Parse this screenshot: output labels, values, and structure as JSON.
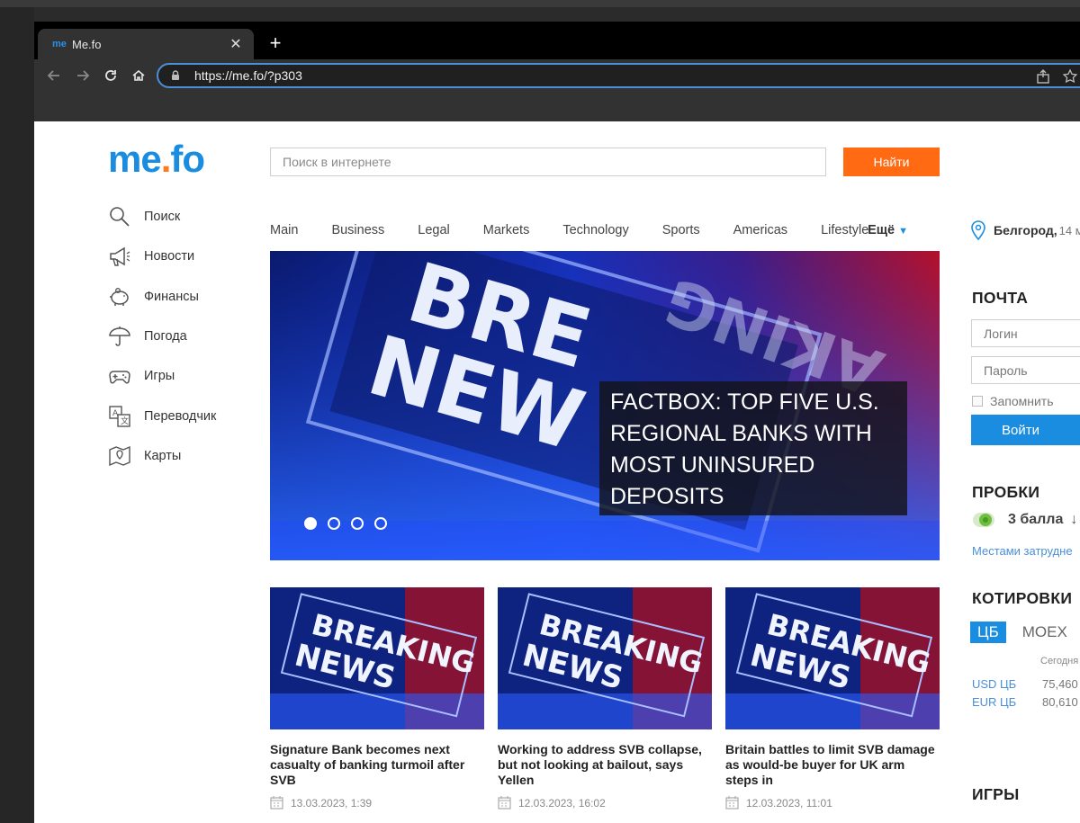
{
  "browser": {
    "tab_title": "Me.fo",
    "tab_favicon": "me",
    "url": "https://me.fo/?p303"
  },
  "site": {
    "logo_me": "me",
    "logo_dot": ".",
    "logo_fo": "fo",
    "search_placeholder": "Поиск в интернете",
    "search_button": "Найти",
    "sidenav": [
      {
        "label": "Поиск",
        "icon": "search-icon"
      },
      {
        "label": "Новости",
        "icon": "megaphone-icon"
      },
      {
        "label": "Финансы",
        "icon": "piggy-bank-icon"
      },
      {
        "label": "Погода",
        "icon": "umbrella-icon"
      },
      {
        "label": "Игры",
        "icon": "gamepad-icon"
      },
      {
        "label": "Переводчик",
        "icon": "translate-icon"
      },
      {
        "label": "Карты",
        "icon": "map-icon"
      }
    ],
    "topnav": [
      "Main",
      "Business",
      "Legal",
      "Markets",
      "Technology",
      "Sports",
      "Americas",
      "Lifestyle"
    ],
    "topnav_more": "Ещё",
    "hero": {
      "caption": "FACTBOX: TOP FIVE U.S. REGIONAL BANKS WITH MOST UNINSURED DEPOSITS",
      "slides": 4,
      "active_slide": 1
    },
    "cards": [
      {
        "title": "Signature Bank becomes next casualty of banking turmoil after SVB",
        "date": "13.03.2023, 1:39"
      },
      {
        "title": "Working to address SVB collapse, but not looking at bailout, says Yellen",
        "date": "12.03.2023, 16:02"
      },
      {
        "title": "Britain battles to limit SVB damage as would-be buyer for UK arm steps in",
        "date": "12.03.2023, 11:01"
      }
    ]
  },
  "right": {
    "city": "Белгород,",
    "city_temp": "14 м",
    "mail_title": "ПОЧТА",
    "login_placeholder": "Логин",
    "password_placeholder": "Пароль",
    "remember_label": "Запомнить",
    "login_button": "Войти",
    "traffic_title": "ПРОБКИ",
    "traffic_score": "3 балла",
    "traffic_desc": "Местами затрудне",
    "quotes_title": "КОТИРОВКИ",
    "quotes_tab_cb": "ЦБ",
    "quotes_tab_moex": "МОЕХ",
    "quotes_header": "Сегодня",
    "quotes": [
      {
        "name": "USD ЦБ",
        "value": "75,460"
      },
      {
        "name": "EUR ЦБ",
        "value": "80,610"
      }
    ],
    "games_title": "ИГРЫ"
  },
  "colors": {
    "brand_blue": "#1a8de0",
    "brand_orange": "#ff6a13",
    "link_blue": "#4a90d9"
  }
}
